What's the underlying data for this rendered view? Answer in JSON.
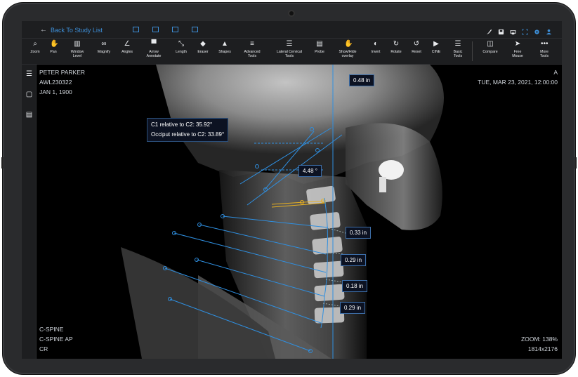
{
  "topbar": {
    "back_label": "Back To Study List",
    "layout_icons": [
      "layout-1x1-icon",
      "layout-1x2-icon",
      "layout-2x1-icon",
      "layout-2x2-icon"
    ],
    "right_icons": [
      "brush-icon",
      "save-icon",
      "print-icon",
      "fullscreen-icon",
      "settings-icon",
      "user-icon"
    ]
  },
  "toolbar": {
    "tools": [
      {
        "label": "Zoom",
        "icon": "search-icon",
        "glyph": "⌕"
      },
      {
        "label": "Pan",
        "icon": "hand-icon",
        "glyph": "✋"
      },
      {
        "label": "Window\nLevel",
        "icon": "window-level-icon",
        "glyph": "▥"
      },
      {
        "label": "Magnify",
        "icon": "binoculars-icon",
        "glyph": "∞"
      },
      {
        "label": "Angles",
        "icon": "angle-icon",
        "glyph": "∠"
      },
      {
        "label": "Arrow\nAnnotate",
        "icon": "annotate-icon",
        "glyph": "▀"
      },
      {
        "label": "Length",
        "icon": "length-icon",
        "glyph": "⤡"
      },
      {
        "label": "Eraser",
        "icon": "eraser-icon",
        "glyph": "◆"
      },
      {
        "label": "Shapes",
        "icon": "shapes-icon",
        "glyph": "▲"
      },
      {
        "label": "Advanced\nTools",
        "icon": "menu-icon",
        "glyph": "≡"
      },
      {
        "label": "Lateral Cervical\nTools",
        "icon": "list-icon",
        "glyph": "☰"
      },
      {
        "label": "Probe",
        "icon": "probe-icon",
        "glyph": "▤"
      },
      {
        "label": "Show/Hide\noverlay",
        "icon": "overlay-icon",
        "glyph": "✋"
      },
      {
        "label": "Invert",
        "icon": "invert-icon",
        "glyph": "◐"
      },
      {
        "label": "Rotate",
        "icon": "rotate-icon",
        "glyph": "↻"
      },
      {
        "label": "Reset",
        "icon": "reset-icon",
        "glyph": "↺"
      },
      {
        "label": "CINE",
        "icon": "cine-icon",
        "glyph": "▶"
      },
      {
        "label": "Basic\nTools",
        "icon": "basic-tools-icon",
        "glyph": "☰"
      },
      {
        "label": "Compare",
        "icon": "compare-icon",
        "glyph": "◫"
      },
      {
        "label": "Free\nMouse",
        "icon": "cursor-icon",
        "glyph": "➤"
      },
      {
        "label": "More\nTools",
        "icon": "more-icon",
        "glyph": "•••"
      }
    ]
  },
  "sidebar": {
    "items": [
      {
        "icon": "hamburger-icon",
        "glyph": "☰"
      },
      {
        "icon": "square-icon",
        "glyph": "▢"
      },
      {
        "icon": "document-icon",
        "glyph": "▤"
      }
    ]
  },
  "overlay": {
    "patient_name": "PETER PARKER",
    "patient_id": "AWL230322",
    "dob": "JAN 1, 1900",
    "orientation": "A",
    "study_datetime": "TUE, MAR 23, 2021, 12:00:00",
    "series_1": "C-SPINE",
    "series_2": "C-SPINE AP",
    "modality": "CR",
    "zoom": "ZOOM: 138%",
    "dimensions": "1814x2176"
  },
  "measurements": {
    "top_distance": "0.48 in",
    "c1_c2_angle": "C1 relative to C2: 35.92°",
    "occiput_c2_angle": "Occiput relative to C2: 33.89°",
    "small_angle": "4.48 °",
    "dist_1": "0.33 in",
    "dist_2": "0.29 in",
    "dist_3": "0.18 in",
    "dist_4": "0.29 in"
  },
  "colors": {
    "accent": "#3d8fd8",
    "measure_line": "#2f8fe0",
    "angle_line": "#e8b020",
    "background": "#000000"
  }
}
